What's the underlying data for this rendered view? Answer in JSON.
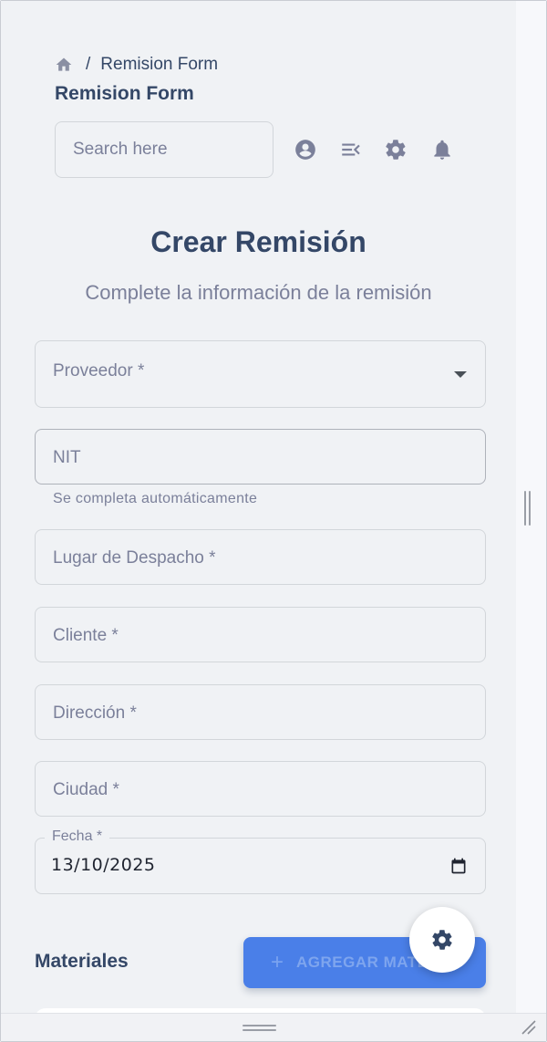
{
  "breadcrumb": {
    "current": "Remision Form",
    "separator": "/"
  },
  "header": {
    "title": "Remision Form"
  },
  "search": {
    "placeholder": "Search here"
  },
  "form": {
    "title": "Crear Remisión",
    "subtitle": "Complete la información de la remisión",
    "fields": {
      "proveedor": "Proveedor *",
      "nit": "NIT",
      "nit_helper": "Se completa automáticamente",
      "lugar_despacho": "Lugar de Despacho *",
      "cliente": "Cliente *",
      "direccion": "Dirección *",
      "ciudad": "Ciudad *",
      "fecha_label": "Fecha *",
      "fecha_value": "13/10/2025"
    }
  },
  "materials": {
    "title": "Materiales",
    "add_button_label": "AGREGAR MATE",
    "add_button_icon": "+"
  },
  "colors": {
    "primary": "#4a7fe8",
    "text": "#344767",
    "muted": "#7b809a",
    "background": "#f0f2f5"
  }
}
